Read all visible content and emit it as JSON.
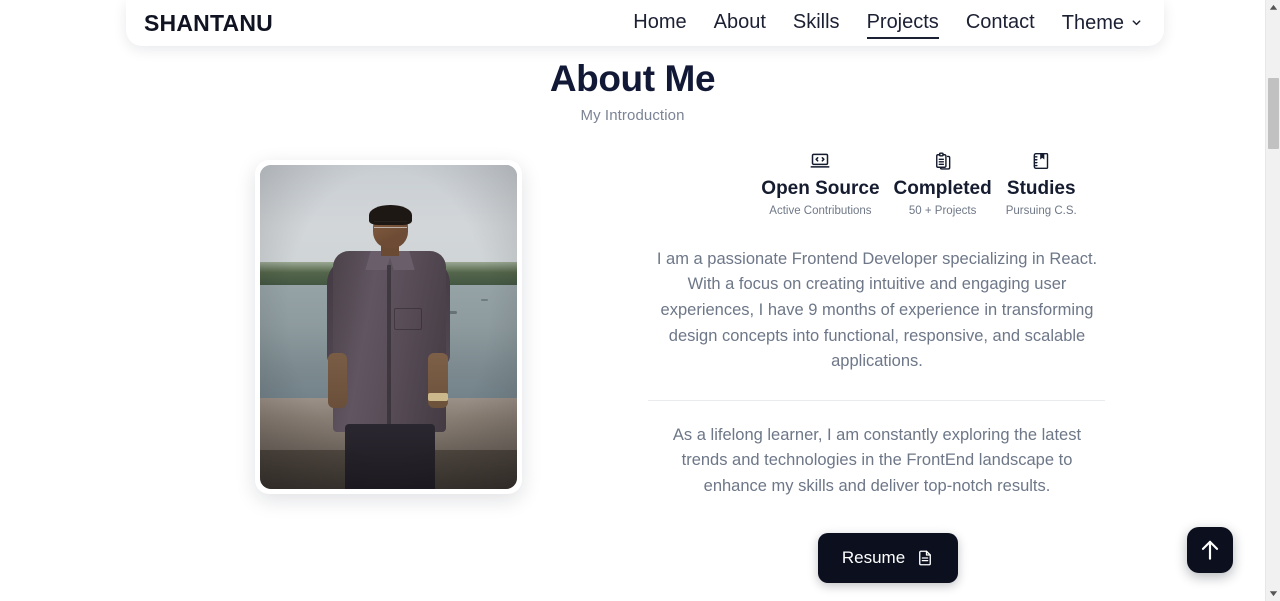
{
  "navbar": {
    "brand": "SHANTANU",
    "links": [
      {
        "label": "Home",
        "active": false
      },
      {
        "label": "About",
        "active": false
      },
      {
        "label": "Skills",
        "active": false
      },
      {
        "label": "Projects",
        "active": true
      },
      {
        "label": "Contact",
        "active": false
      }
    ],
    "theme": {
      "label": "Theme",
      "icon": "chevron-down-icon"
    }
  },
  "section": {
    "title": "About Me",
    "subtitle": "My Introduction"
  },
  "profile": {
    "image_alt": "Portrait photo of Shantanu standing in front of a lake"
  },
  "stats": [
    {
      "icon": "laptop-code-icon",
      "title": "Open Source",
      "subtitle": "Active Contributions"
    },
    {
      "icon": "clipboard-stack-icon",
      "title": "Completed",
      "subtitle": "50 + Projects"
    },
    {
      "icon": "notebook-bookmark-icon",
      "title": "Studies",
      "subtitle": "Pursuing C.S."
    }
  ],
  "bio": {
    "paragraph1": "I am a passionate Frontend Developer specializing in React. With a focus on creating intuitive and engaging user experiences, I have 9 months of experience in transforming design concepts into functional, responsive, and scalable applications.",
    "paragraph2": "As a lifelong learner, I am constantly exploring the latest trends and technologies in the FrontEnd landscape to enhance my skills and deliver top-notch results."
  },
  "resume_button": {
    "label": "Resume",
    "icon": "document-icon"
  },
  "scroll_top_button": {
    "icon": "arrow-up-icon"
  },
  "scrollbar": {
    "up_icon": "scroll-up-arrow-icon",
    "down_icon": "scroll-down-arrow-icon"
  },
  "colors": {
    "page_bg": "#ffffff",
    "heading": "#111936",
    "body_text": "#6d7788",
    "muted_text": "#7b8494",
    "accent_dark": "#0b0f1e",
    "divider": "#e9ebee"
  }
}
